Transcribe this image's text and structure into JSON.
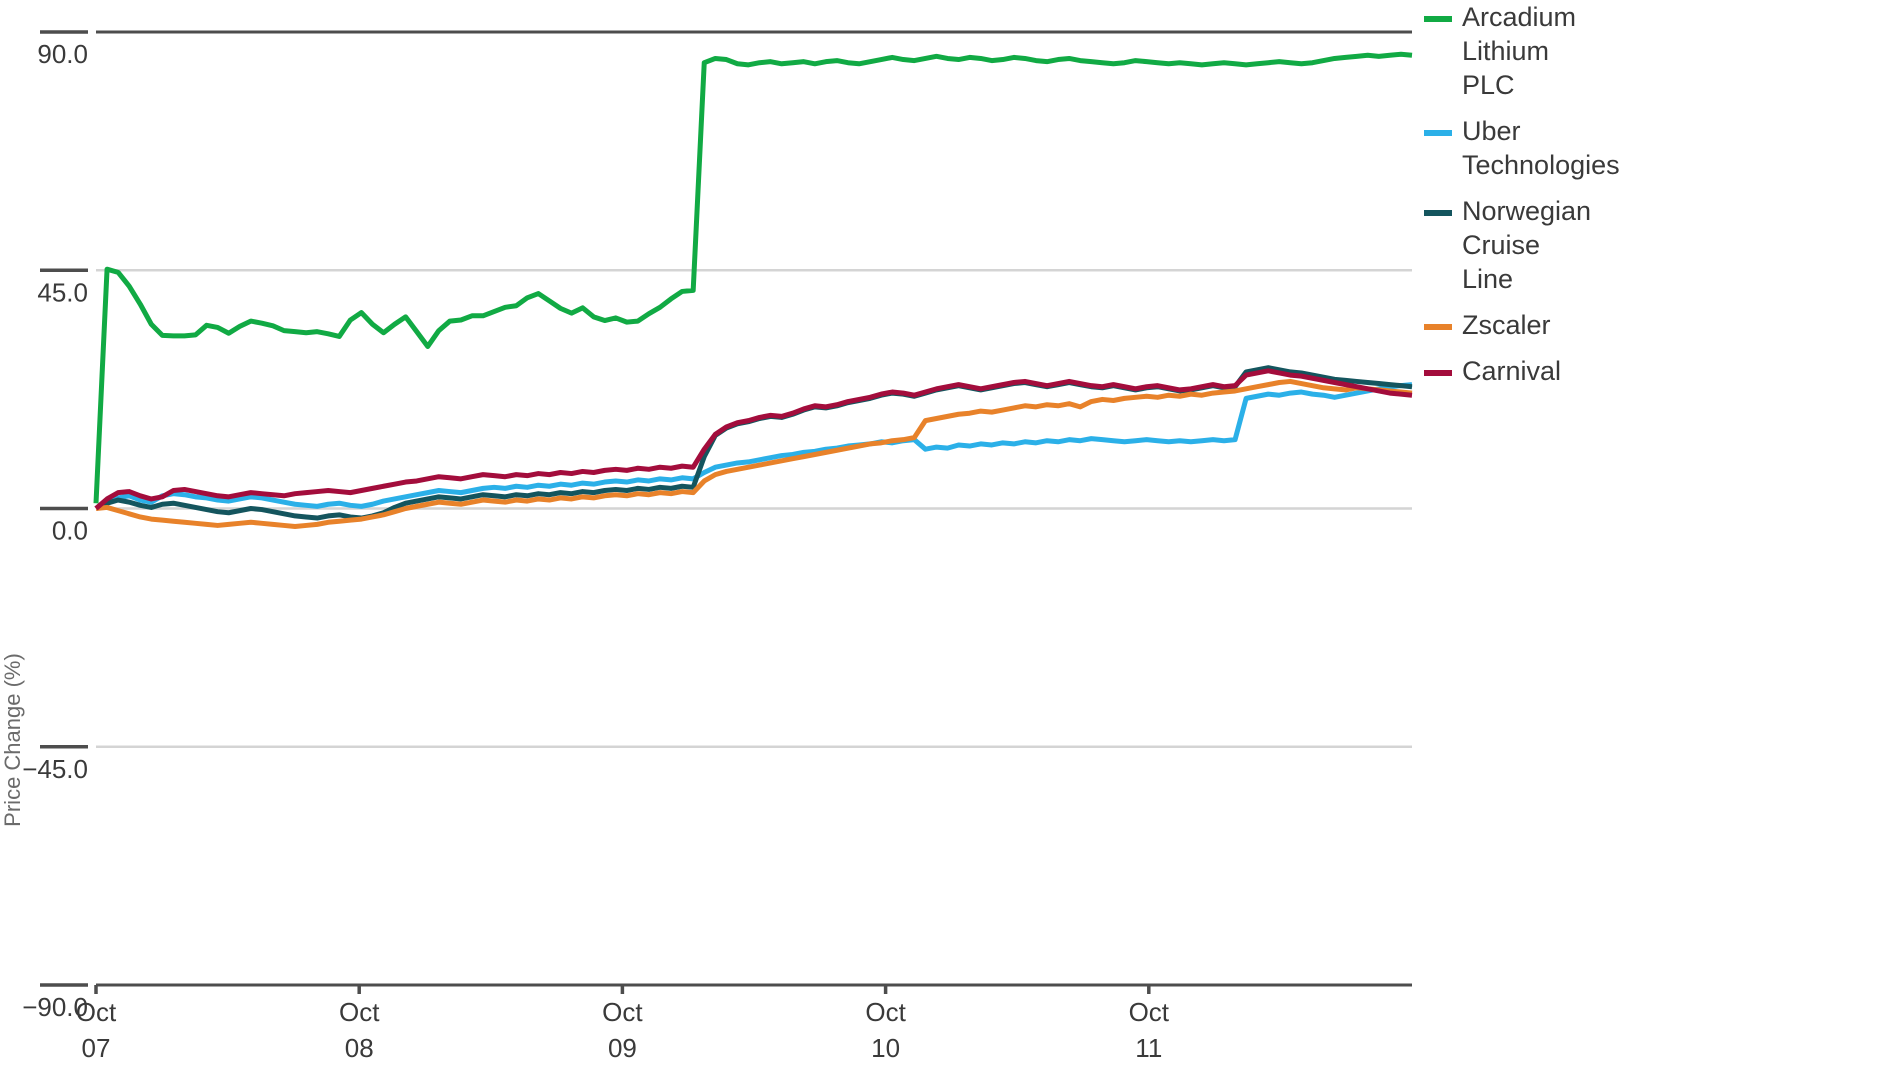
{
  "chart_data": {
    "type": "line",
    "title": "",
    "subtitle": "",
    "xlabel": "",
    "ylabel": "Price Change (%)",
    "ylim": [
      -90.0,
      90.0
    ],
    "ytick_labels": [
      "90.0",
      "45.0",
      "0.0",
      "-45.0",
      "-90.0"
    ],
    "ytick_values": [
      90.0,
      45.0,
      0.0,
      -45.0,
      -90.0
    ],
    "xtick_labels": [
      {
        "top": "Oct",
        "bottom": "07"
      },
      {
        "top": "Oct",
        "bottom": "08"
      },
      {
        "top": "Oct",
        "bottom": "09"
      },
      {
        "top": "Oct",
        "bottom": "10"
      },
      {
        "top": "Oct",
        "bottom": "11"
      }
    ],
    "xtick_values": [
      0,
      48,
      96,
      144,
      192
    ],
    "xlim": [
      0,
      240
    ],
    "grid": true,
    "legend_position": "right",
    "colors": {
      "arcadium": "#11aa44",
      "uber": "#2bb0e8",
      "norwegian": "#14555e",
      "zscaler": "#e8822a",
      "carnival": "#a30d3c"
    },
    "series": [
      {
        "name": "Arcadium Lithium PLC",
        "color": "#11aa44",
        "values": [
          1.0,
          45.2,
          44.6,
          42.0,
          38.6,
          34.8,
          32.7,
          32.6,
          32.6,
          32.8,
          34.6,
          34.2,
          33.1,
          34.4,
          35.4,
          35.0,
          34.5,
          33.6,
          33.4,
          33.2,
          33.4,
          33.0,
          32.5,
          35.6,
          37.0,
          34.8,
          33.2,
          34.8,
          36.2,
          33.4,
          30.6,
          33.6,
          35.4,
          35.6,
          36.4,
          36.4,
          37.2,
          38.0,
          38.3,
          39.8,
          40.6,
          39.2,
          37.8,
          36.9,
          37.9,
          36.2,
          35.5,
          36.0,
          35.2,
          35.4,
          36.8,
          38.0,
          39.6,
          41.0,
          41.2,
          84.2,
          85.0,
          84.8,
          84.0,
          83.8,
          84.2,
          84.4,
          84.0,
          84.2,
          84.4,
          84.0,
          84.4,
          84.6,
          84.2,
          84.0,
          84.4,
          84.8,
          85.2,
          84.8,
          84.6,
          85.0,
          85.4,
          85.0,
          84.8,
          85.2,
          85.0,
          84.6,
          84.8,
          85.2,
          85.0,
          84.6,
          84.4,
          84.8,
          85.0,
          84.6,
          84.4,
          84.2,
          84.0,
          84.2,
          84.6,
          84.4,
          84.2,
          84.0,
          84.2,
          84.0,
          83.8,
          84.0,
          84.2,
          84.0,
          83.8,
          84.0,
          84.2,
          84.4,
          84.2,
          84.0,
          84.2,
          84.6,
          85.0,
          85.2,
          85.4,
          85.6,
          85.4,
          85.6,
          85.8,
          85.6
        ]
      },
      {
        "name": "Uber Technologies",
        "color": "#2bb0e8",
        "values": [
          0.0,
          1.4,
          2.0,
          2.4,
          1.6,
          1.2,
          2.4,
          2.8,
          2.6,
          2.2,
          2.0,
          1.6,
          1.4,
          1.8,
          2.2,
          2.0,
          1.6,
          1.2,
          0.8,
          0.6,
          0.4,
          0.8,
          1.0,
          0.6,
          0.4,
          0.8,
          1.4,
          1.8,
          2.2,
          2.6,
          3.0,
          3.4,
          3.2,
          3.0,
          3.4,
          3.8,
          4.0,
          3.8,
          4.2,
          4.0,
          4.4,
          4.2,
          4.6,
          4.4,
          4.8,
          4.6,
          5.0,
          5.2,
          5.0,
          5.4,
          5.2,
          5.6,
          5.4,
          5.8,
          5.6,
          6.8,
          7.8,
          8.2,
          8.6,
          8.8,
          9.2,
          9.6,
          10.0,
          10.2,
          10.6,
          10.8,
          11.2,
          11.4,
          11.8,
          12.0,
          12.2,
          12.6,
          12.4,
          12.8,
          13.0,
          11.2,
          11.6,
          11.4,
          12.0,
          11.8,
          12.2,
          12.0,
          12.4,
          12.2,
          12.6,
          12.4,
          12.8,
          12.6,
          13.0,
          12.8,
          13.2,
          13.0,
          12.8,
          12.6,
          12.8,
          13.0,
          12.8,
          12.6,
          12.8,
          12.6,
          12.8,
          13.0,
          12.8,
          13.0,
          20.8,
          21.2,
          21.6,
          21.4,
          21.8,
          22.0,
          21.6,
          21.4,
          21.0,
          21.4,
          21.8,
          22.2,
          22.6,
          23.0,
          23.2,
          23.4
        ]
      },
      {
        "name": "Norwegian Cruise Line",
        "color": "#14555e",
        "values": [
          0.0,
          1.0,
          1.6,
          1.2,
          0.6,
          0.2,
          0.8,
          1.0,
          0.6,
          0.2,
          -0.2,
          -0.6,
          -0.8,
          -0.4,
          0.0,
          -0.2,
          -0.6,
          -1.0,
          -1.4,
          -1.6,
          -1.8,
          -1.4,
          -1.2,
          -1.6,
          -1.8,
          -1.4,
          -0.8,
          0.2,
          1.0,
          1.4,
          1.8,
          2.2,
          2.0,
          1.8,
          2.2,
          2.6,
          2.4,
          2.2,
          2.6,
          2.4,
          2.8,
          2.6,
          3.0,
          2.8,
          3.2,
          3.0,
          3.4,
          3.6,
          3.4,
          3.8,
          3.6,
          4.0,
          3.8,
          4.2,
          4.0,
          9.8,
          13.8,
          15.2,
          16.0,
          16.4,
          17.0,
          17.4,
          17.2,
          17.8,
          18.6,
          19.2,
          19.0,
          19.4,
          20.0,
          20.4,
          20.8,
          21.4,
          21.8,
          21.6,
          21.2,
          21.8,
          22.4,
          22.8,
          23.2,
          22.8,
          22.4,
          22.8,
          23.2,
          23.6,
          23.8,
          23.4,
          23.0,
          23.4,
          23.8,
          23.4,
          23.0,
          22.8,
          23.2,
          22.8,
          22.4,
          22.8,
          23.0,
          22.6,
          22.2,
          22.4,
          22.8,
          23.2,
          22.8,
          23.0,
          25.8,
          26.2,
          26.6,
          26.2,
          25.8,
          25.6,
          25.2,
          24.8,
          24.4,
          24.2,
          24.0,
          23.8,
          23.6,
          23.4,
          23.2,
          23.0
        ]
      },
      {
        "name": "Zscaler",
        "color": "#e8822a",
        "values": [
          0.0,
          0.2,
          -0.4,
          -1.0,
          -1.6,
          -2.0,
          -2.2,
          -2.4,
          -2.6,
          -2.8,
          -3.0,
          -3.2,
          -3.0,
          -2.8,
          -2.6,
          -2.8,
          -3.0,
          -3.2,
          -3.4,
          -3.2,
          -3.0,
          -2.6,
          -2.4,
          -2.2,
          -2.0,
          -1.6,
          -1.2,
          -0.6,
          0.0,
          0.4,
          0.8,
          1.2,
          1.0,
          0.8,
          1.2,
          1.6,
          1.4,
          1.2,
          1.6,
          1.4,
          1.8,
          1.6,
          2.0,
          1.8,
          2.2,
          2.0,
          2.4,
          2.6,
          2.4,
          2.8,
          2.6,
          3.0,
          2.8,
          3.2,
          3.0,
          5.2,
          6.4,
          7.0,
          7.4,
          7.8,
          8.2,
          8.6,
          9.0,
          9.4,
          9.8,
          10.2,
          10.6,
          11.0,
          11.4,
          11.8,
          12.2,
          12.4,
          12.8,
          13.0,
          13.4,
          16.6,
          17.0,
          17.4,
          17.8,
          18.0,
          18.4,
          18.2,
          18.6,
          19.0,
          19.4,
          19.2,
          19.6,
          19.4,
          19.8,
          19.2,
          20.2,
          20.6,
          20.4,
          20.8,
          21.0,
          21.2,
          21.0,
          21.4,
          21.2,
          21.6,
          21.4,
          21.8,
          22.0,
          22.2,
          22.6,
          23.0,
          23.4,
          23.8,
          24.0,
          23.6,
          23.2,
          22.8,
          22.6,
          22.4,
          22.8,
          22.6,
          22.4,
          22.2,
          22.0,
          21.8
        ]
      },
      {
        "name": "Carnival",
        "color": "#a30d3c",
        "values": [
          0.0,
          1.8,
          3.0,
          3.2,
          2.4,
          1.8,
          2.2,
          3.4,
          3.6,
          3.2,
          2.8,
          2.4,
          2.2,
          2.6,
          3.0,
          2.8,
          2.6,
          2.4,
          2.8,
          3.0,
          3.2,
          3.4,
          3.2,
          3.0,
          3.4,
          3.8,
          4.2,
          4.6,
          5.0,
          5.2,
          5.6,
          6.0,
          5.8,
          5.6,
          6.0,
          6.4,
          6.2,
          6.0,
          6.4,
          6.2,
          6.6,
          6.4,
          6.8,
          6.6,
          7.0,
          6.8,
          7.2,
          7.4,
          7.2,
          7.6,
          7.4,
          7.8,
          7.6,
          8.0,
          7.8,
          11.2,
          14.0,
          15.4,
          16.2,
          16.6,
          17.2,
          17.6,
          17.4,
          18.0,
          18.8,
          19.4,
          19.2,
          19.6,
          20.2,
          20.6,
          21.0,
          21.6,
          22.0,
          21.8,
          21.4,
          22.0,
          22.6,
          23.0,
          23.4,
          23.0,
          22.6,
          23.0,
          23.4,
          23.8,
          24.0,
          23.6,
          23.2,
          23.6,
          24.0,
          23.6,
          23.2,
          23.0,
          23.4,
          23.0,
          22.6,
          23.0,
          23.2,
          22.8,
          22.4,
          22.6,
          23.0,
          23.4,
          23.0,
          23.2,
          25.2,
          25.6,
          26.0,
          25.6,
          25.2,
          25.0,
          24.6,
          24.2,
          23.8,
          23.4,
          23.0,
          22.6,
          22.2,
          21.8,
          21.6,
          21.4
        ]
      }
    ]
  },
  "legend": {
    "items": [
      {
        "label_lines": [
          "Arcadium",
          "Lithium",
          "PLC"
        ],
        "color": "#11aa44"
      },
      {
        "label_lines": [
          "Uber",
          "Technologies"
        ],
        "color": "#2bb0e8"
      },
      {
        "label_lines": [
          "Norwegian",
          "Cruise",
          "Line"
        ],
        "color": "#14555e"
      },
      {
        "label_lines": [
          "Zscaler"
        ],
        "color": "#e8822a"
      },
      {
        "label_lines": [
          "Carnival"
        ],
        "color": "#a30d3c"
      }
    ]
  }
}
